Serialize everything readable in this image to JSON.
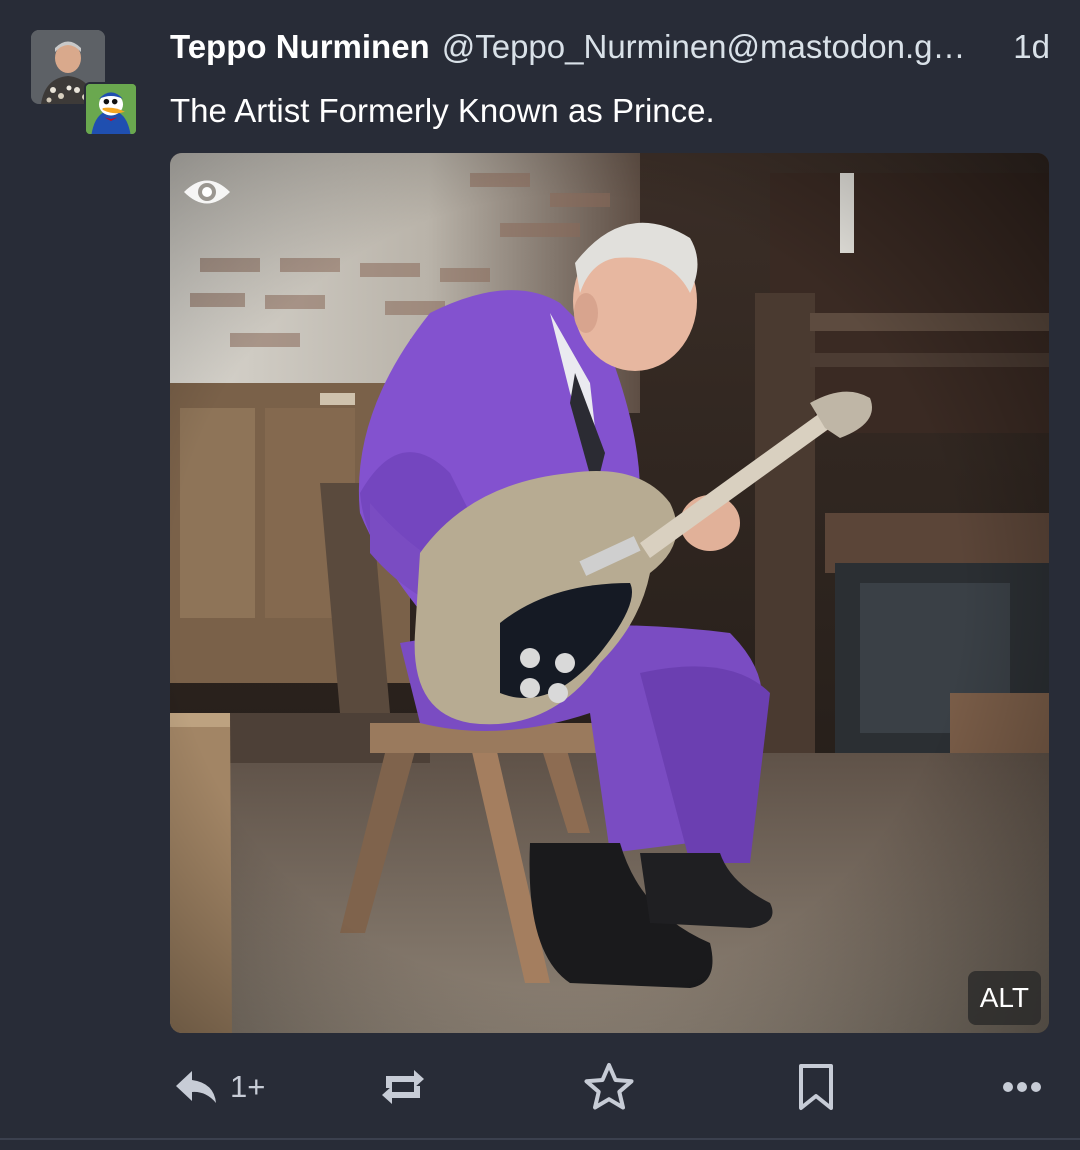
{
  "post": {
    "display_name": "Teppo Nurminen",
    "handle": "@Teppo_Nurminen@mastodon.g…",
    "timestamp": "1d",
    "text": "The Artist Formerly Known as Prince."
  },
  "media": {
    "alt_label": "ALT",
    "reveal_icon": "eye-icon"
  },
  "actions": {
    "reply": {
      "icon": "reply-icon",
      "count": "1+"
    },
    "boost": {
      "icon": "boost-icon"
    },
    "favourite": {
      "icon": "star-icon"
    },
    "bookmark": {
      "icon": "bookmark-icon"
    },
    "more": {
      "icon": "more-icon"
    }
  },
  "colors": {
    "background": "#282c37",
    "secondary_text": "#d9e1e8",
    "icon": "#c7ccd6",
    "suit": "#7a4cc2"
  }
}
